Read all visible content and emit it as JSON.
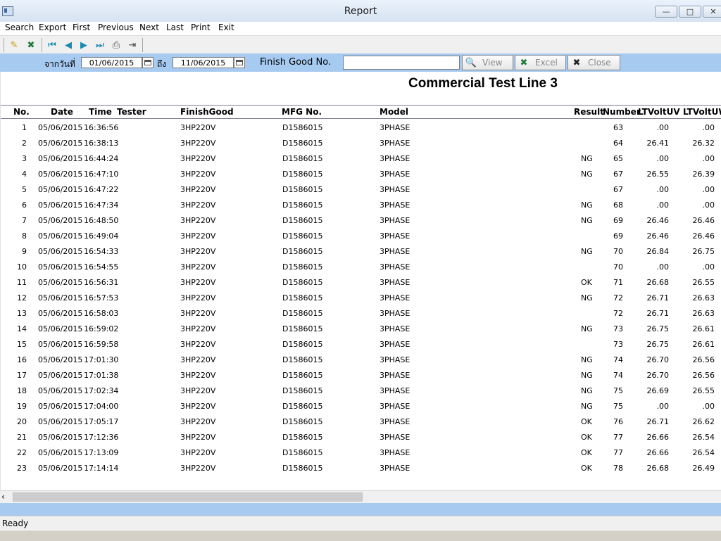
{
  "window": {
    "title": "Report"
  },
  "menu": [
    "Search",
    "Export",
    "First",
    "Previous",
    "Next",
    "Last",
    "Print",
    "Exit"
  ],
  "toolbar_icons": [
    "edit-icon",
    "excel-icon",
    "first-record-icon",
    "previous-record-icon",
    "next-record-icon",
    "last-record-icon",
    "print-icon",
    "exit-icon"
  ],
  "filter": {
    "from_label": "จากวันที่",
    "from_date": "01/06/2015",
    "to_label": "ถึง",
    "to_date": "11/06/2015",
    "fg_label": "Finish Good No.",
    "fg_value": "",
    "view_label": "View",
    "excel_label": "Excel",
    "close_label": "Close"
  },
  "report": {
    "title": "Commercial Test Line 3",
    "columns": [
      "No.",
      "Date",
      "Time",
      "Tester",
      "FinishGood",
      "MFG No.",
      "Model",
      "Result",
      "Number",
      "LTVoltUV",
      "LTVoltUW"
    ],
    "rows": [
      [
        "1",
        "05/06/2015",
        "16:36:56",
        "",
        "3HP220V",
        "D1586015",
        "3PHASE",
        "",
        "63",
        ".00",
        ".00"
      ],
      [
        "2",
        "05/06/2015",
        "16:38:13",
        "",
        "3HP220V",
        "D1586015",
        "3PHASE",
        "",
        "64",
        "26.41",
        "26.32"
      ],
      [
        "3",
        "05/06/2015",
        "16:44:24",
        "",
        "3HP220V",
        "D1586015",
        "3PHASE",
        "NG",
        "65",
        ".00",
        ".00"
      ],
      [
        "4",
        "05/06/2015",
        "16:47:10",
        "",
        "3HP220V",
        "D1586015",
        "3PHASE",
        "NG",
        "67",
        "26.55",
        "26.39"
      ],
      [
        "5",
        "05/06/2015",
        "16:47:22",
        "",
        "3HP220V",
        "D1586015",
        "3PHASE",
        "",
        "67",
        ".00",
        ".00"
      ],
      [
        "6",
        "05/06/2015",
        "16:47:34",
        "",
        "3HP220V",
        "D1586015",
        "3PHASE",
        "NG",
        "68",
        ".00",
        ".00"
      ],
      [
        "7",
        "05/06/2015",
        "16:48:50",
        "",
        "3HP220V",
        "D1586015",
        "3PHASE",
        "NG",
        "69",
        "26.46",
        "26.46"
      ],
      [
        "8",
        "05/06/2015",
        "16:49:04",
        "",
        "3HP220V",
        "D1586015",
        "3PHASE",
        "",
        "69",
        "26.46",
        "26.46"
      ],
      [
        "9",
        "05/06/2015",
        "16:54:33",
        "",
        "3HP220V",
        "D1586015",
        "3PHASE",
        "NG",
        "70",
        "26.84",
        "26.75"
      ],
      [
        "10",
        "05/06/2015",
        "16:54:55",
        "",
        "3HP220V",
        "D1586015",
        "3PHASE",
        "",
        "70",
        ".00",
        ".00"
      ],
      [
        "11",
        "05/06/2015",
        "16:56:31",
        "",
        "3HP220V",
        "D1586015",
        "3PHASE",
        "OK",
        "71",
        "26.68",
        "26.55"
      ],
      [
        "12",
        "05/06/2015",
        "16:57:53",
        "",
        "3HP220V",
        "D1586015",
        "3PHASE",
        "NG",
        "72",
        "26.71",
        "26.63"
      ],
      [
        "13",
        "05/06/2015",
        "16:58:03",
        "",
        "3HP220V",
        "D1586015",
        "3PHASE",
        "",
        "72",
        "26.71",
        "26.63"
      ],
      [
        "14",
        "05/06/2015",
        "16:59:02",
        "",
        "3HP220V",
        "D1586015",
        "3PHASE",
        "NG",
        "73",
        "26.75",
        "26.61"
      ],
      [
        "15",
        "05/06/2015",
        "16:59:58",
        "",
        "3HP220V",
        "D1586015",
        "3PHASE",
        "",
        "73",
        "26.75",
        "26.61"
      ],
      [
        "16",
        "05/06/2015",
        "17:01:30",
        "",
        "3HP220V",
        "D1586015",
        "3PHASE",
        "NG",
        "74",
        "26.70",
        "26.56"
      ],
      [
        "17",
        "05/06/2015",
        "17:01:38",
        "",
        "3HP220V",
        "D1586015",
        "3PHASE",
        "NG",
        "74",
        "26.70",
        "26.56"
      ],
      [
        "18",
        "05/06/2015",
        "17:02:34",
        "",
        "3HP220V",
        "D1586015",
        "3PHASE",
        "NG",
        "75",
        "26.69",
        "26.55"
      ],
      [
        "19",
        "05/06/2015",
        "17:04:00",
        "",
        "3HP220V",
        "D1586015",
        "3PHASE",
        "NG",
        "75",
        ".00",
        ".00"
      ],
      [
        "20",
        "05/06/2015",
        "17:05:17",
        "",
        "3HP220V",
        "D1586015",
        "3PHASE",
        "OK",
        "76",
        "26.71",
        "26.62"
      ],
      [
        "21",
        "05/06/2015",
        "17:12:36",
        "",
        "3HP220V",
        "D1586015",
        "3PHASE",
        "OK",
        "77",
        "26.66",
        "26.54"
      ],
      [
        "22",
        "05/06/2015",
        "17:13:09",
        "",
        "3HP220V",
        "D1586015",
        "3PHASE",
        "OK",
        "77",
        "26.66",
        "26.54"
      ],
      [
        "23",
        "05/06/2015",
        "17:14:14",
        "",
        "3HP220V",
        "D1586015",
        "3PHASE",
        "OK",
        "78",
        "26.68",
        "26.49"
      ]
    ]
  },
  "status": {
    "text": "Ready"
  },
  "colors": {
    "filter_band": "#a6caf0",
    "title_bar": "#dde8f5"
  }
}
